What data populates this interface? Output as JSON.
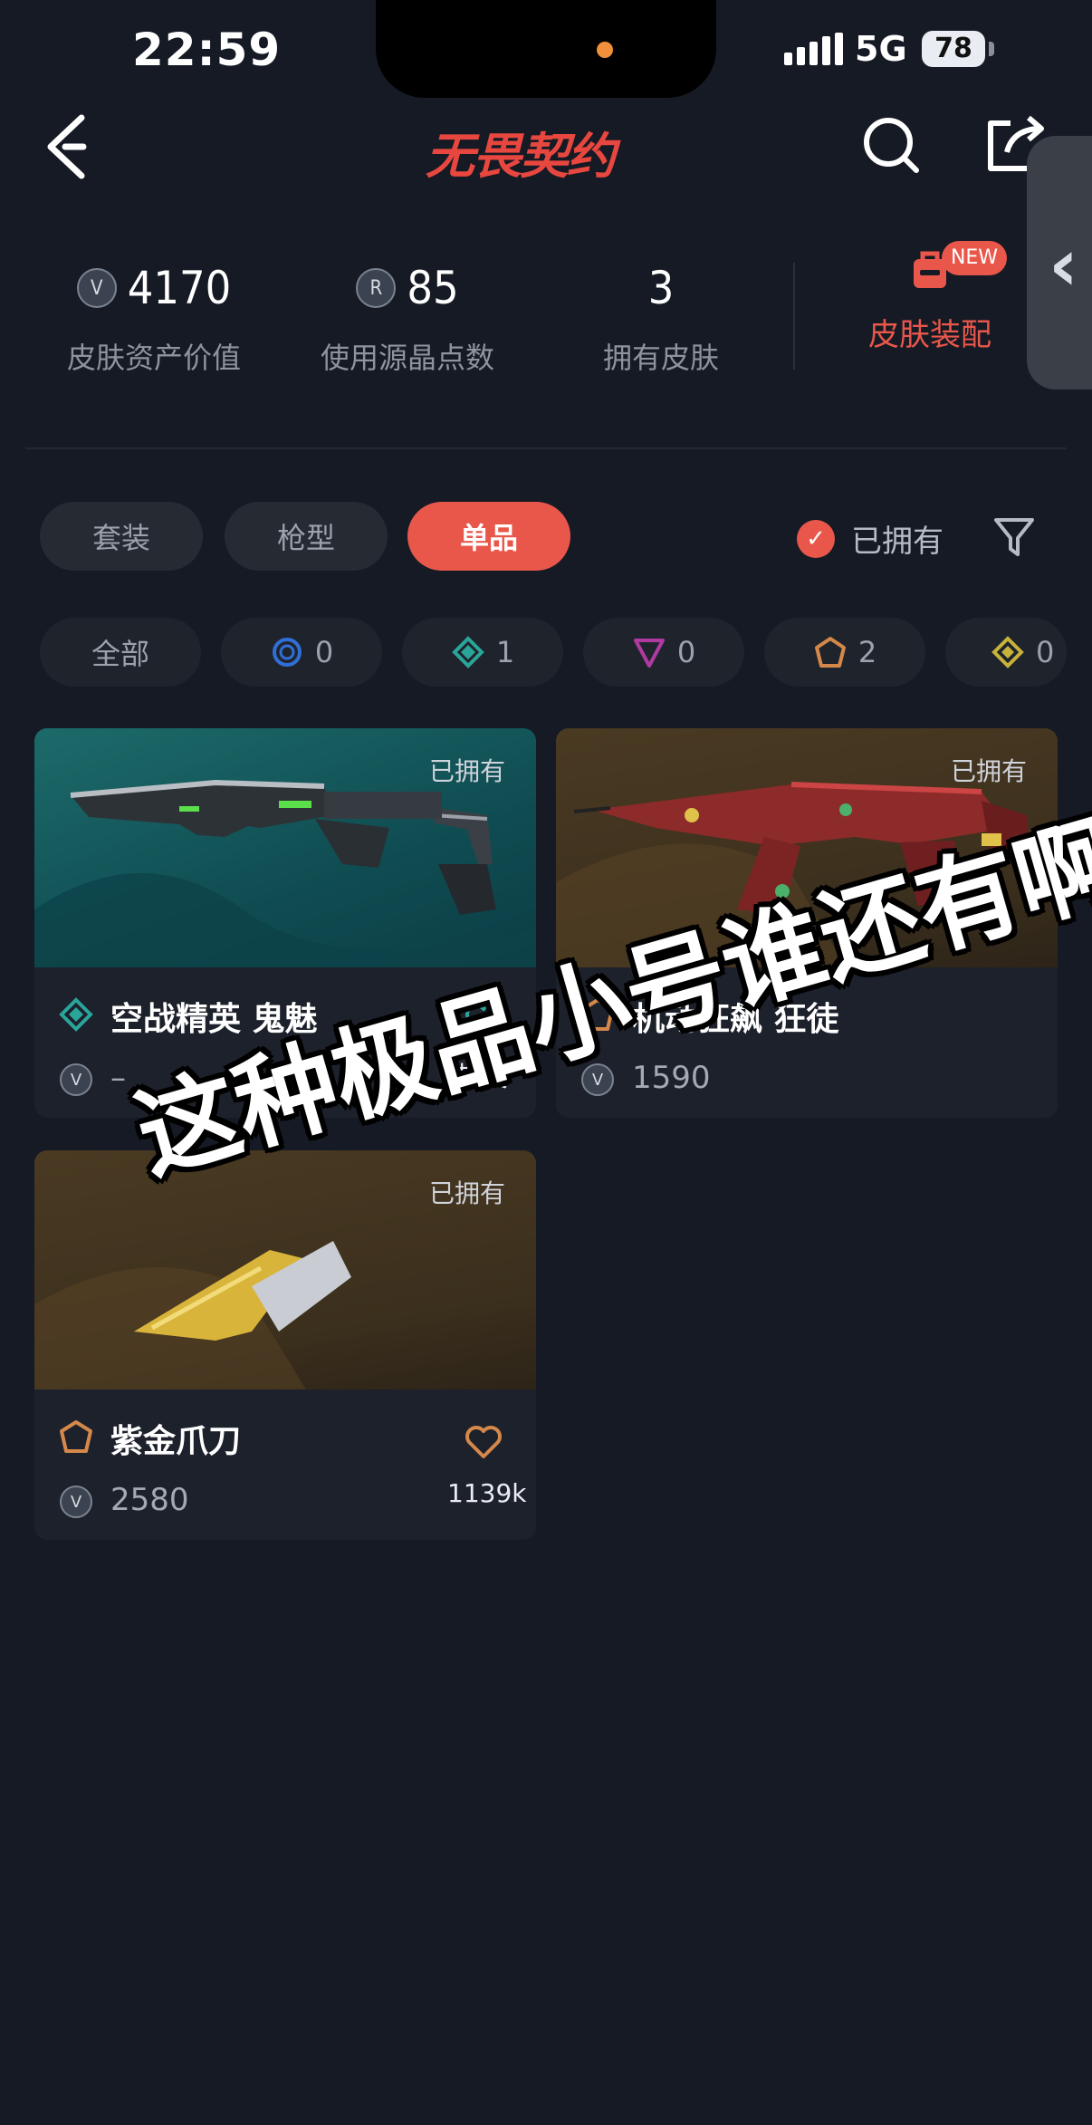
{
  "status_bar": {
    "time": "22:59",
    "network": "5G",
    "battery": "78"
  },
  "header": {
    "logo": "无畏契约"
  },
  "stats": [
    {
      "value": "4170",
      "label": "皮肤资产价值",
      "icon": "v-coin-icon"
    },
    {
      "value": "85",
      "label": "使用源晶点数",
      "icon": "r-coin-icon"
    },
    {
      "value": "3",
      "label": "拥有皮肤"
    }
  ],
  "equip": {
    "label": "皮肤装配",
    "badge": "NEW"
  },
  "tabs": [
    {
      "label": "套装",
      "active": false
    },
    {
      "label": "枪型",
      "active": false
    },
    {
      "label": "单品",
      "active": true
    }
  ],
  "owned_filter": {
    "label": "已拥有",
    "checked": true
  },
  "tier_chips": [
    {
      "label": "全部"
    },
    {
      "count": "0",
      "tier": "blue",
      "color": "#2f6fd6"
    },
    {
      "count": "1",
      "tier": "teal",
      "color": "#2aa59a"
    },
    {
      "count": "0",
      "tier": "purple",
      "color": "#b03aa2"
    },
    {
      "count": "2",
      "tier": "orange",
      "color": "#d4884a"
    },
    {
      "count": "0",
      "tier": "gold",
      "color": "#c7b23a"
    }
  ],
  "cards": [
    {
      "name": "空战精英 鬼魅",
      "price": "–",
      "owned": "已拥有",
      "action": "想要",
      "tier_color": "#2aa59a"
    },
    {
      "name": "机动狂飙 狂徒",
      "price": "1590",
      "owned": "已拥有",
      "action": "",
      "tier_color": "#d4884a"
    },
    {
      "name": "紫金爪刀",
      "price": "2580",
      "owned": "已拥有",
      "action": "1139k",
      "tier_color": "#d4884a"
    }
  ],
  "overlay_caption": "这种极品小号谁还有啊",
  "colors": {
    "accent": "#e9574b",
    "background": "#151a24"
  }
}
